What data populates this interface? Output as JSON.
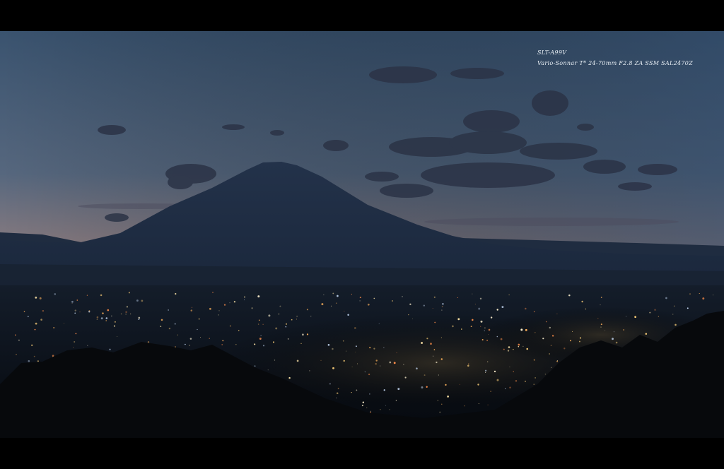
{
  "caption": {
    "camera_model": "SLT-A99V",
    "lens": "Vario-Sonnar T* 24-70mm F2.8 ZA SSM SAL2470Z"
  },
  "scene": {
    "subject": "mountain-silhouette",
    "colors": {
      "sky_top": "#3d5672",
      "sky_mid": "#5a6a80",
      "horizon_glow": "#c9916c",
      "mountain": "#1b2a40",
      "city_lights": "#ffd27a",
      "letterbox": "#000000"
    }
  }
}
